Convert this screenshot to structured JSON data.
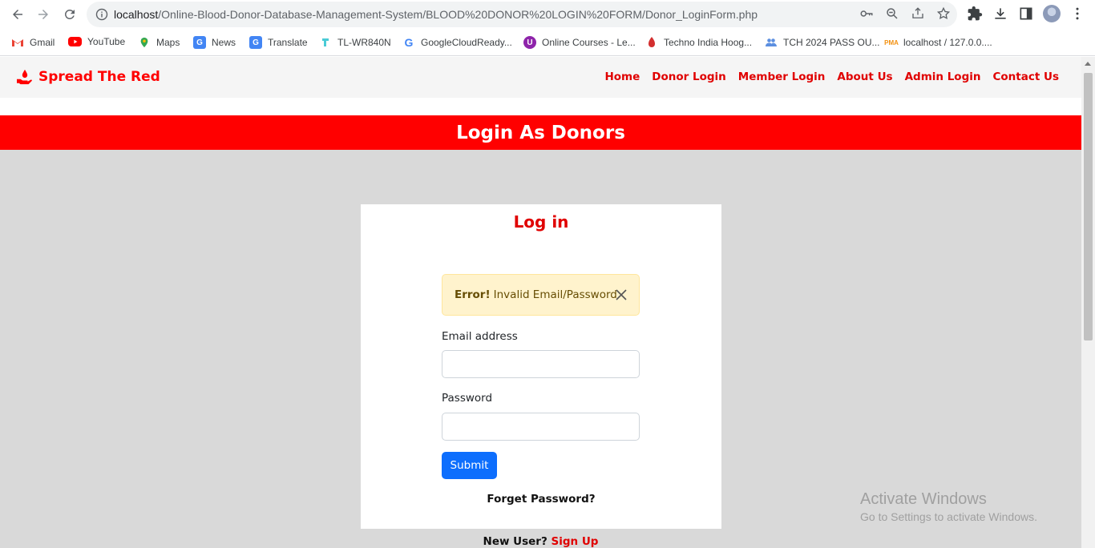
{
  "browser": {
    "url_host": "localhost",
    "url_path": "/Online-Blood-Donor-Database-Management-System/BLOOD%20DONOR%20LOGIN%20FORM/Donor_LoginForm.php",
    "bookmarks": [
      {
        "label": "Gmail",
        "icon": "gmail-icon",
        "color": "#ea4335"
      },
      {
        "label": "YouTube",
        "icon": "youtube-icon",
        "color": "#ff0000"
      },
      {
        "label": "Maps",
        "icon": "maps-icon",
        "color": "#34a853"
      },
      {
        "label": "News",
        "icon": "news-icon",
        "color": "#4285f4"
      },
      {
        "label": "Translate",
        "icon": "translate-icon",
        "color": "#4285f4"
      },
      {
        "label": "TL-WR840N",
        "icon": "tplink-icon",
        "color": "#4acbd6"
      },
      {
        "label": "GoogleCloudReady...",
        "icon": "google-icon",
        "color": "#4285f4"
      },
      {
        "label": "Online Courses - Le...",
        "icon": "courses-icon",
        "color": "#8e24aa"
      },
      {
        "label": "Techno India Hoog...",
        "icon": "techno-india-icon",
        "color": "#d32f2f"
      },
      {
        "label": "TCH 2024 PASS OU...",
        "icon": "people-icon",
        "color": "#5c8fe0"
      },
      {
        "label": "localhost / 127.0.0....",
        "icon": "phpmyadmin-icon",
        "color": "#f29111"
      }
    ]
  },
  "site": {
    "brand": "Spread The Red",
    "menu": [
      "Home",
      "Donor Login",
      "Member Login",
      "About Us",
      "Admin Login",
      "Contact Us"
    ],
    "banner": "Login As Donors",
    "accent_color": "#ff0000"
  },
  "form": {
    "title": "Log in",
    "alert_strong": "Error!",
    "alert_text": "Invalid Email/Password",
    "email_label": "Email address",
    "email_value": "",
    "password_label": "Password",
    "password_value": "",
    "submit_label": "Submit",
    "forgot_label": "Forget Password?",
    "new_user_label": "New User?",
    "sign_up_label": "Sign Up"
  },
  "watermark": {
    "line1": "Activate Windows",
    "line2": "Go to Settings to activate Windows."
  }
}
